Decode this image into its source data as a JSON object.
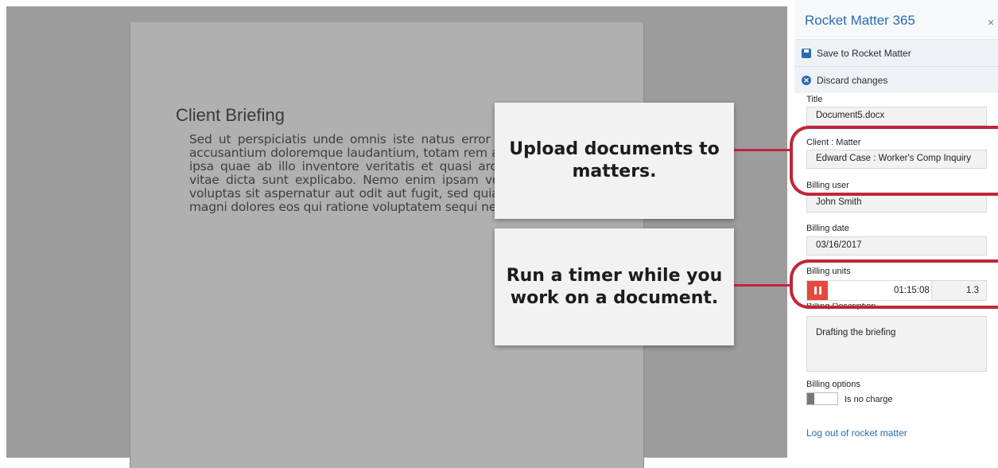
{
  "document": {
    "title": "Client Briefing",
    "body": "Sed ut perspiciatis unde omnis iste natus error sit voluptatem accusantium doloremque laudantium, totam rem aperiam, eaque ipsa quae ab illo inventore veritatis et quasi architecto beatae vitae dicta sunt explicabo. Nemo enim ipsam voluptatem quia voluptas sit aspernatur aut odit aut fugit, sed quia consequuntur magni dolores eos qui ratione voluptatem sequi nesciunt."
  },
  "callouts": {
    "upload": "Upload documents to matters.",
    "timer": "Run a timer while you work on a document."
  },
  "panel": {
    "title": "Rocket Matter 365",
    "close": "×",
    "save_label": "Save to Rocket Matter",
    "discard_label": "Discard changes",
    "fields": {
      "title_label": "Title",
      "title_value": "Document5.docx",
      "client_matter_label": "Client : Matter",
      "client_matter_value": "Edward Case : Worker's Comp Inquiry",
      "billing_user_label": "Billing user",
      "billing_user_value": "John Smith",
      "billing_date_label": "Billing date",
      "billing_date_value": "03/16/2017",
      "billing_units_label": "Billing units",
      "timer_value": "01:15:08",
      "units_value": "1.3",
      "billing_description_label": "Billing Description",
      "billing_description_value": "Drafting the briefing",
      "billing_options_label": "Billing options",
      "no_charge_label": "Is no charge"
    },
    "logout_label": "Log out of rocket matter"
  },
  "colors": {
    "accent": "#2b6cb0",
    "highlight": "#c0263a",
    "pause": "#e5483d"
  },
  "icons": [
    "save-icon",
    "discard-icon",
    "pause-icon",
    "close-icon"
  ]
}
